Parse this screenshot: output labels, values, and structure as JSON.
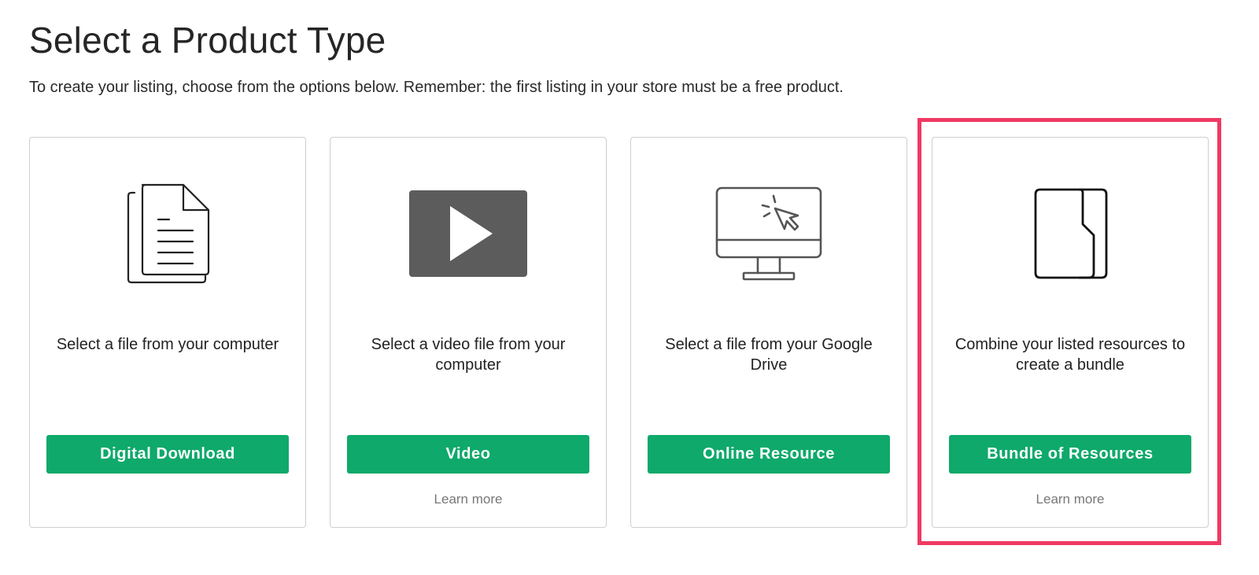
{
  "page": {
    "title": "Select a Product Type",
    "subtitle": "To create your listing, choose from the options below. Remember: the first listing in your store must be a free product."
  },
  "cards": [
    {
      "icon": "document-icon",
      "description": "Select a file from your computer",
      "button_label": "Digital Download",
      "learn_more": ""
    },
    {
      "icon": "video-play-icon",
      "description": "Select a video file from your computer",
      "button_label": "Video",
      "learn_more": "Learn more"
    },
    {
      "icon": "computer-monitor-icon",
      "description": "Select a file from your Google Drive",
      "button_label": "Online Resource",
      "learn_more": ""
    },
    {
      "icon": "bundle-folder-icon",
      "description": "Combine your listed resources to create a bundle",
      "button_label": "Bundle of Resources",
      "learn_more": "Learn more"
    }
  ],
  "colors": {
    "button": "#0ea96b",
    "highlight": "#f03a63",
    "video_icon": "#5c5c5c"
  }
}
